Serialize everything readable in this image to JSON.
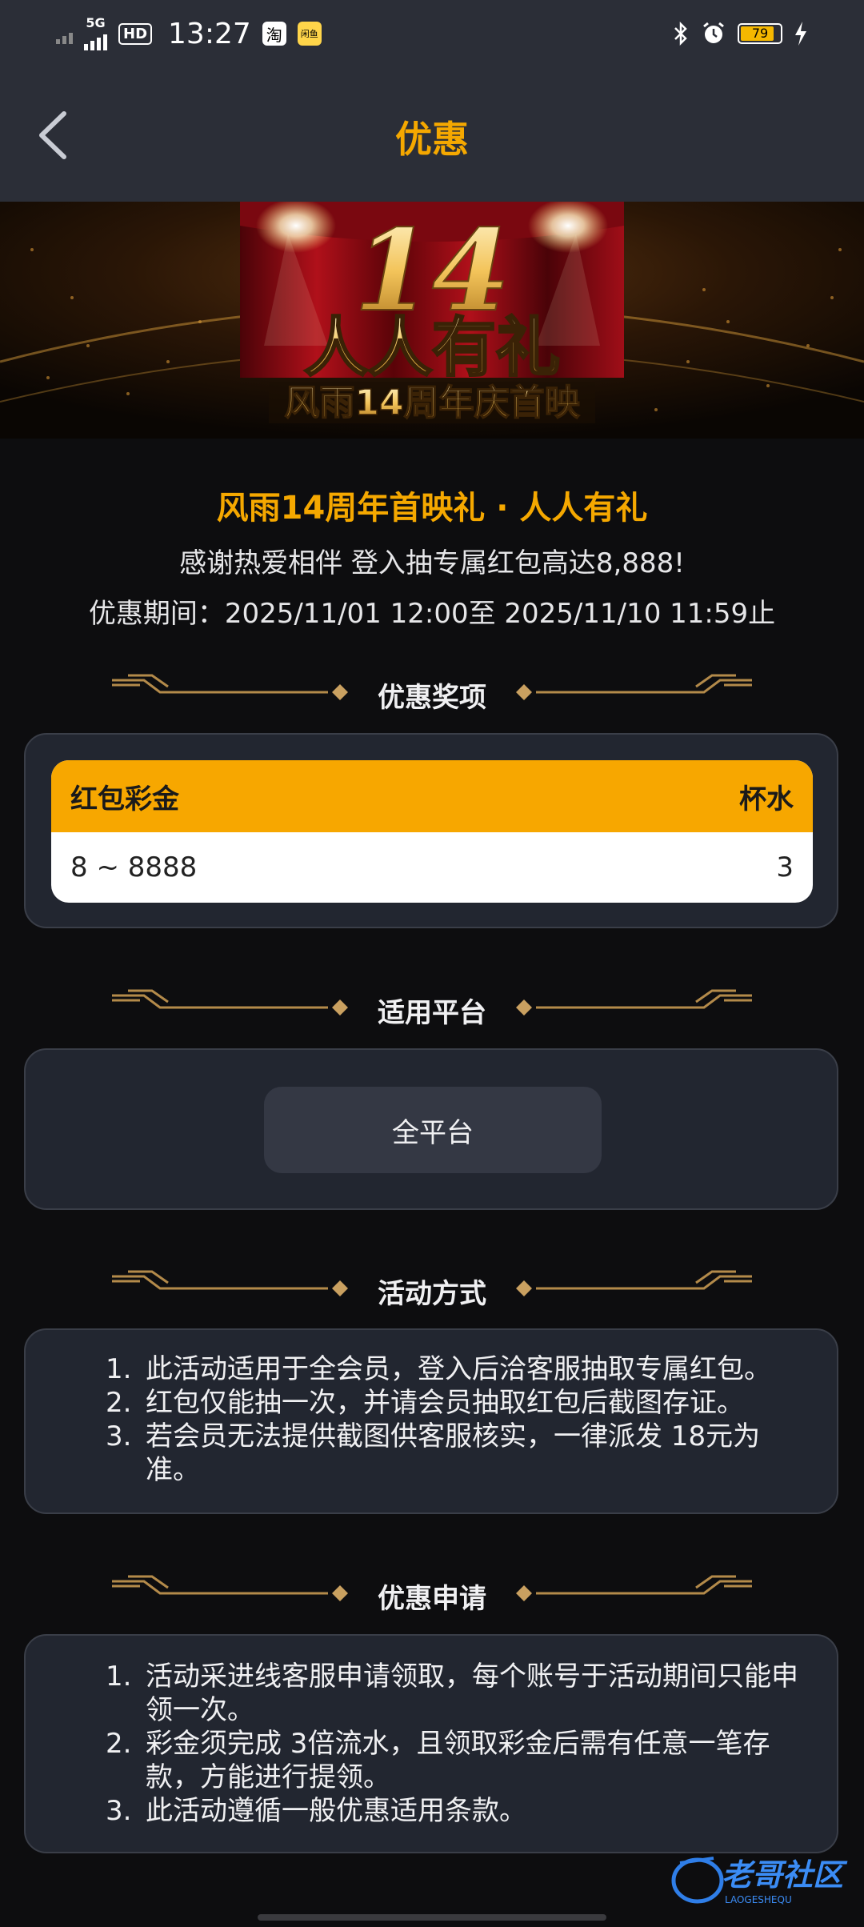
{
  "status_bar": {
    "network": "5G",
    "hd": "HD",
    "time": "13:27",
    "app1": "淘",
    "app2": "闲鱼",
    "battery": "79",
    "icons": [
      "bluetooth-icon",
      "alarm-icon",
      "charging-icon"
    ]
  },
  "nav": {
    "title": "优惠"
  },
  "banner": {
    "logo_number": "14",
    "headline": "人人有礼",
    "subline": "风雨14周年庆首映"
  },
  "intro": {
    "headline": "风雨14周年首映礼 · 人人有礼",
    "subtitle": "感谢热爱相伴 登入抽专属红包高达8,888!",
    "period": "优惠期间：2025/11/01 12:00至 2025/11/10 11:59止"
  },
  "sections": {
    "prizes": {
      "title": "优惠奖项",
      "col1": "红包彩金",
      "col2": "杯水",
      "row": {
        "amount": "8 ~ 8888",
        "turnover": "3"
      }
    },
    "platform": {
      "title": "适用平台",
      "value": "全平台"
    },
    "method": {
      "title": "活动方式",
      "items": [
        "此活动适用于全会员，登入后洽客服抽取专属红包。",
        "红包仅能抽一次，并请会员抽取红包后截图存证。",
        "若会员无法提供截图供客服核实，一律派发 18元为准。"
      ]
    },
    "apply": {
      "title": "优惠申请",
      "items": [
        "活动采进线客服申请领取，每个账号于活动期间只能申领一次。",
        "彩金须完成 3倍流水，且领取彩金后需有任意一笔存款，方能进行提领。",
        "此活动遵循一般优惠适用条款。"
      ]
    }
  },
  "watermark": {
    "text": "老哥社区",
    "sub": "LAOGESHEQU"
  },
  "colors": {
    "accent": "#f5a800",
    "card_bg": "#222630",
    "page_bg": "#0d0d0f",
    "nav_bg": "#2b2e37"
  }
}
